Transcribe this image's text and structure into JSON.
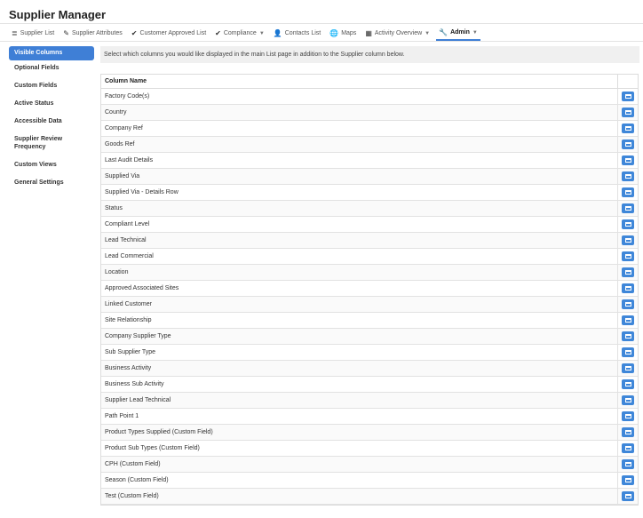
{
  "app": {
    "title": "Supplier Manager"
  },
  "nav": [
    {
      "label": "Supplier List",
      "icon": "list-icon",
      "glyph": "≣"
    },
    {
      "label": "Supplier Attributes",
      "icon": "edit-icon",
      "glyph": "✎"
    },
    {
      "label": "Customer Approved List",
      "icon": "check-icon",
      "glyph": "✔"
    },
    {
      "label": "Compliance",
      "icon": "check-icon",
      "glyph": "✔",
      "dropdown": true
    },
    {
      "label": "Contacts List",
      "icon": "user-icon",
      "glyph": "👤"
    },
    {
      "label": "Maps",
      "icon": "globe-icon",
      "glyph": "🌐"
    },
    {
      "label": "Activity Overview",
      "icon": "calendar-icon",
      "glyph": "▦",
      "dropdown": true
    },
    {
      "label": "Admin",
      "icon": "wrench-icon",
      "glyph": "🔧",
      "dropdown": true,
      "active": true
    }
  ],
  "sidebar": {
    "items": [
      {
        "label": "Visible Columns",
        "active": true
      },
      {
        "label": "Optional Fields"
      },
      {
        "label": "Custom Fields"
      },
      {
        "label": "Active Status"
      },
      {
        "label": "Accessible Data"
      },
      {
        "label": "Supplier Review Frequency"
      },
      {
        "label": "Custom Views"
      },
      {
        "label": "General Settings"
      }
    ]
  },
  "main": {
    "instructions": "Select which columns you would like displayed in the main List page in addition to the Supplier column below.",
    "table": {
      "header": "Column Name",
      "rows": [
        "Factory Code(s)",
        "Country",
        "Company Ref",
        "Goods Ref",
        "Last Audit Details",
        "Supplied Via",
        "Supplied Via - Details Row",
        "Status",
        "Compliant Level",
        "Lead Technical",
        "Lead Commercial",
        "Location",
        "Approved Associated Sites",
        "Linked Customer",
        "Site Relationship",
        "Company Supplier Type",
        "Sub Supplier Type",
        "Business Activity",
        "Business Sub Activity",
        "Supplier Lead Technical",
        "Path Point 1",
        "Product Types Supplied (Custom Field)",
        "Product Sub Types (Custom Field)",
        "CPH (Custom Field)",
        "Season (Custom Field)",
        "Test (Custom Field)"
      ]
    }
  },
  "colors": {
    "accent": "#3f7fd6",
    "button": "#3f87d9"
  }
}
